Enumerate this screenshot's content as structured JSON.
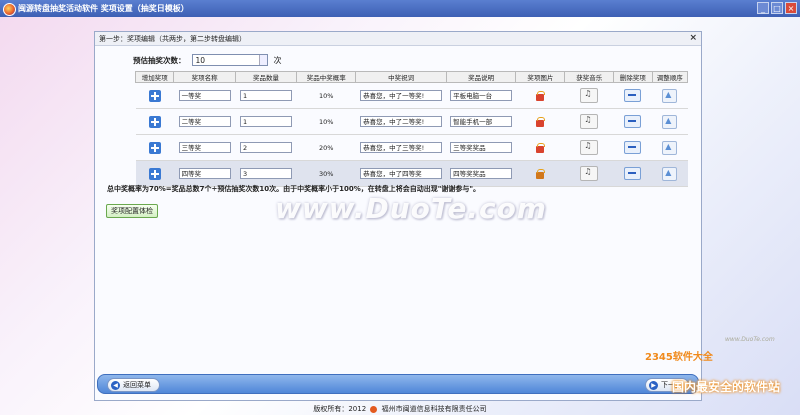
{
  "window": {
    "title": "闽源转盘抽奖活动软件      奖项设置（抽奖日模板）",
    "btn_min": "_",
    "btn_max": "□",
    "btn_close": "×"
  },
  "dialog": {
    "title": "第一步：奖项编辑（共两步，第二步转盘编辑）",
    "close": "×",
    "draw_label": "预估抽奖次数：",
    "draw_value": "10",
    "draw_unit": "次"
  },
  "table": {
    "headers": [
      "增加奖项",
      "奖项名称",
      "奖品数量",
      "奖品中奖概率",
      "中奖祝词",
      "奖品说明",
      "奖项图片",
      "获奖音乐",
      "删除奖项",
      "调整顺序"
    ],
    "rows": [
      {
        "name": "一等奖",
        "qty": "1",
        "prob": "10%",
        "msg": "恭喜您，中了一等奖!",
        "desc": "平板电脑一台"
      },
      {
        "name": "二等奖",
        "qty": "1",
        "prob": "10%",
        "msg": "恭喜您，中了二等奖!",
        "desc": "智能手机一部"
      },
      {
        "name": "三等奖",
        "qty": "2",
        "prob": "20%",
        "msg": "恭喜您，中了三等奖!",
        "desc": "三等奖奖品"
      },
      {
        "name": "四等奖",
        "qty": "3",
        "prob": "30%",
        "msg": "恭喜您，中了四等奖",
        "desc": "四等奖奖品"
      }
    ]
  },
  "summary": "总中奖概率为70%=奖品总数7个÷预估抽奖次数10次。由于中奖概率小于100%，在转盘上将会自动出现\"谢谢参与\"。",
  "check_button": "奖项配置体检",
  "watermark": "www.DuoTe.com",
  "nav": {
    "back": "返回菜单",
    "next": "下一步"
  },
  "footer": {
    "copyright": "版权所有：2012",
    "company": "福州市闽道信息科技有限责任公司"
  },
  "site_watermark": {
    "brand": "2345软件大全",
    "slogan": "国内最安全的软件站",
    "url": "www.DuoTe.com"
  }
}
